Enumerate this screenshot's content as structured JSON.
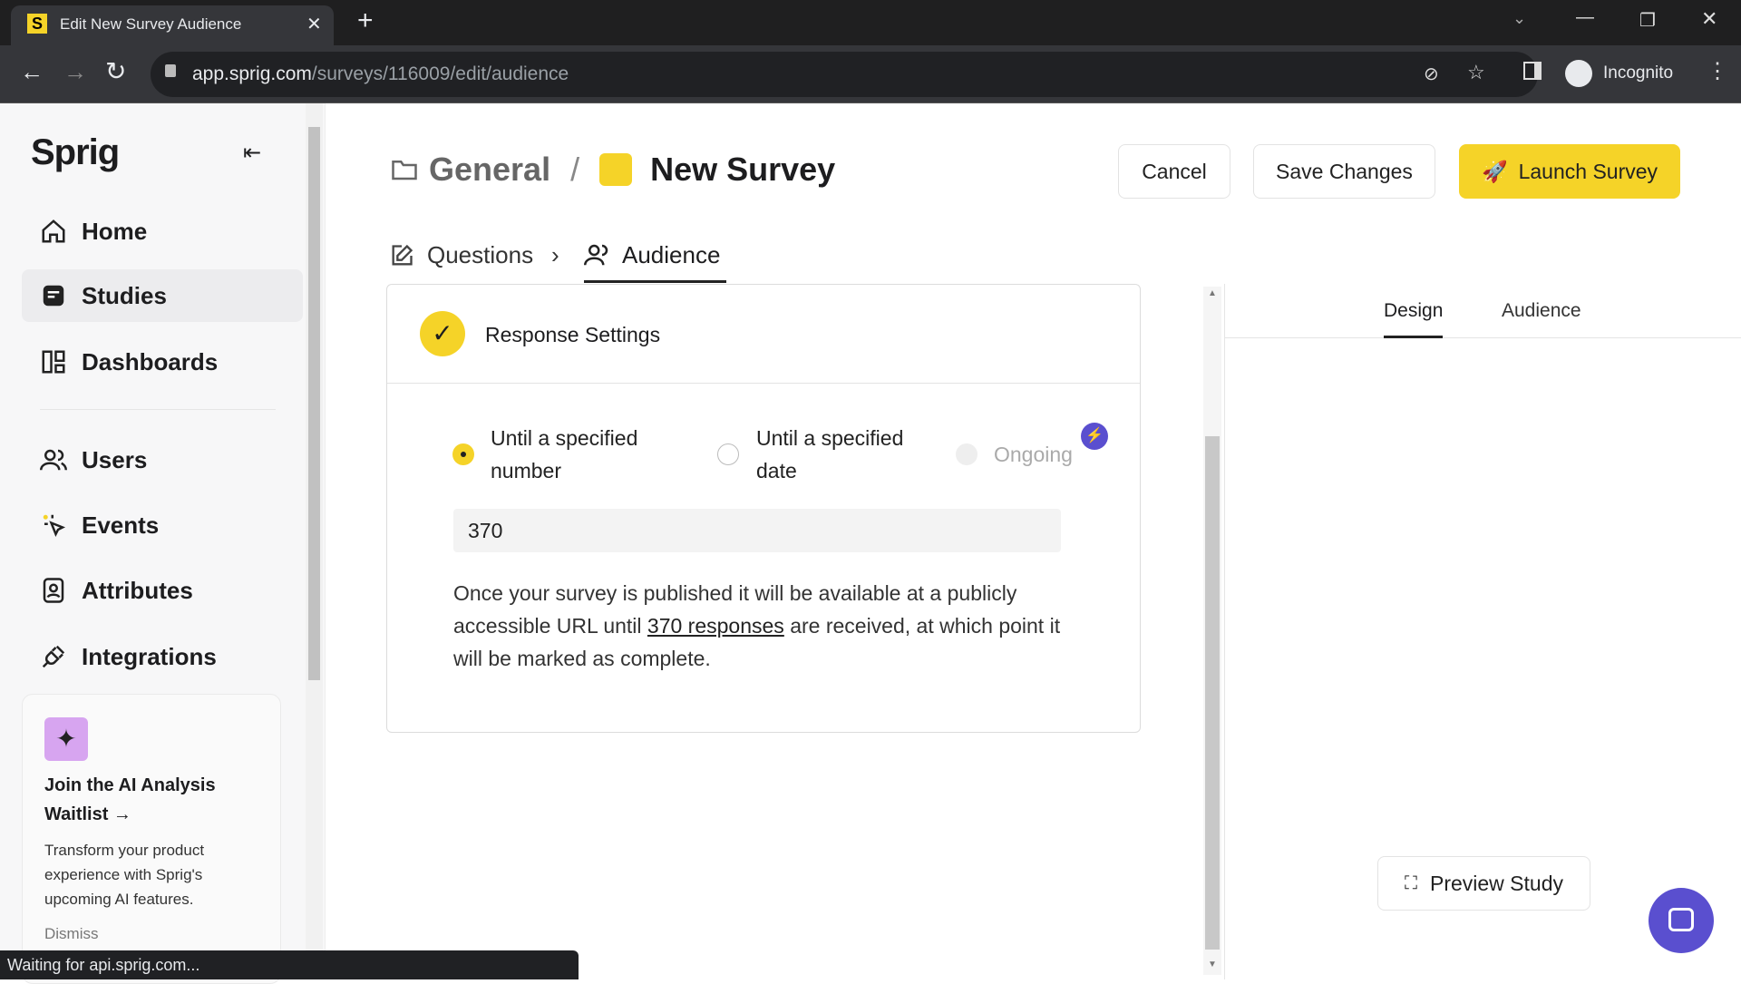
{
  "browser": {
    "tab_title": "Edit New Survey Audience",
    "url_host": "app.sprig.com",
    "url_path": "/surveys/116009/edit/audience",
    "profile": "Incognito",
    "status": "Waiting for api.sprig.com..."
  },
  "sidebar": {
    "logo": "Sprig",
    "items": [
      {
        "label": "Home"
      },
      {
        "label": "Studies"
      },
      {
        "label": "Dashboards"
      },
      {
        "label": "Users"
      },
      {
        "label": "Events"
      },
      {
        "label": "Attributes"
      },
      {
        "label": "Integrations"
      }
    ],
    "promo": {
      "title": "Join the AI Analysis Waitlist →",
      "body": "Transform your product experience with Sprig's upcoming AI features.",
      "dismiss": "Dismiss"
    }
  },
  "header": {
    "folder": "General",
    "separator": "/",
    "survey": "New Survey",
    "cancel": "Cancel",
    "save": "Save Changes",
    "launch": "Launch Survey"
  },
  "steps": {
    "questions": "Questions",
    "audience": "Audience"
  },
  "card": {
    "title": "Response Settings",
    "options": [
      {
        "label": "Until a specified number",
        "selected": true
      },
      {
        "label": "Until a specified date",
        "selected": false
      },
      {
        "label": "Ongoing",
        "selected": false,
        "disabled": true
      }
    ],
    "input_value": "370",
    "desc_pre": "Once your survey is published it will be available at a publicly accessible URL until ",
    "desc_link": "370 responses",
    "desc_post": " are received, at which point it will be marked as complete."
  },
  "preview": {
    "tabs": [
      "Design",
      "Audience"
    ],
    "active_tab": "Design",
    "preview_button": "Preview Study"
  },
  "colors": {
    "accent": "#f5d328",
    "purple": "#5a4fcf",
    "promo_icon_bg": "#d7a5f0"
  }
}
